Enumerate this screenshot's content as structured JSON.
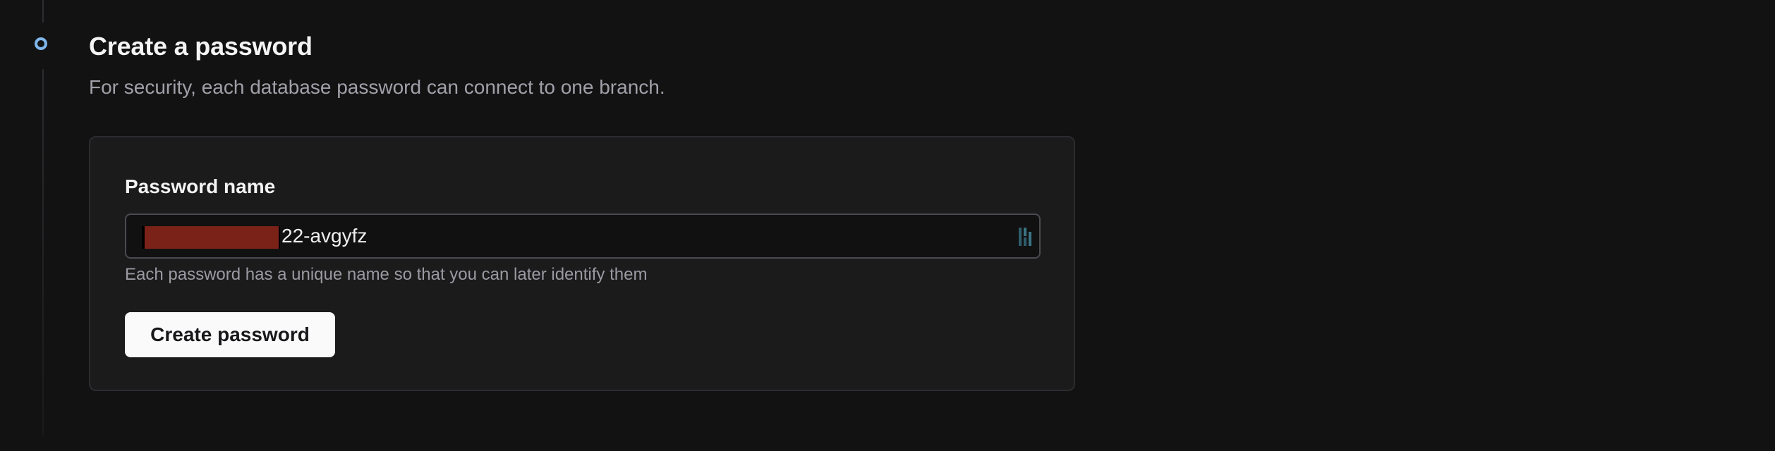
{
  "step": {
    "title": "Create a password",
    "subtitle": "For security, each database password can connect to one branch."
  },
  "form": {
    "password_name_label": "Password name",
    "password_name_value": "22-avgyfz",
    "helper_text": "Each password has a unique name so that you can later identify them",
    "create_button_label": "Create password"
  },
  "colors": {
    "background": "#121213",
    "card_background": "#1b1b1c",
    "step_marker": "#7fb6ea",
    "redaction": "#7a2218",
    "button_background": "#fafafa"
  },
  "icons": {
    "step_marker": "step-circle-icon",
    "input_accessory": "password-manager-icon"
  }
}
